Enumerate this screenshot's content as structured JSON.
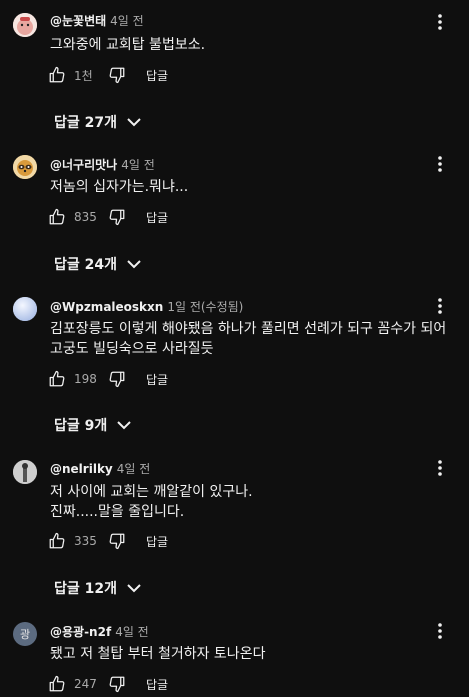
{
  "comments": [
    {
      "author": "@눈꽃변태",
      "time": "4일 전",
      "edited": "",
      "text": "그와중에 교회탑 불법보소.",
      "likes": "1천",
      "reply_label": "답글",
      "replies": "답글 27개",
      "avatar_color": "#f3dcd6"
    },
    {
      "author": "@너구리맛나",
      "time": "4일 전",
      "edited": "",
      "text": "저놈의 십자가는.뭐냐...",
      "likes": "835",
      "reply_label": "답글",
      "replies": "답글 24개",
      "avatar_color": "#e8c27a"
    },
    {
      "author": "@Wpzmaleoskxn",
      "time": "1일 전",
      "edited": "(수정됨)",
      "text": "김포장릉도 이렇게 해야됐음 하나가 풀리면 선례가 되구 꼼수가 되어 고궁도 빌딩숙으로 사라질듯",
      "likes": "198",
      "reply_label": "답글",
      "replies": "답글 9개",
      "avatar_color": "#c5d4f0"
    },
    {
      "author": "@nelrilky",
      "time": "4일 전",
      "edited": "",
      "text_lines": [
        "저 사이에 교회는 깨알같이 있구나.",
        "진짜.....말을 줄입니다."
      ],
      "likes": "335",
      "reply_label": "답글",
      "replies": "답글 12개",
      "avatar_color": "#b9b9b9"
    },
    {
      "author": "@용광-n2f",
      "time": "4일 전",
      "edited": "",
      "text": "됐고 저 철탑 부터 철거하자 토나온다",
      "likes": "247",
      "reply_label": "답글",
      "avatar_letter": "광",
      "avatar_color": "#5c6b80"
    }
  ]
}
